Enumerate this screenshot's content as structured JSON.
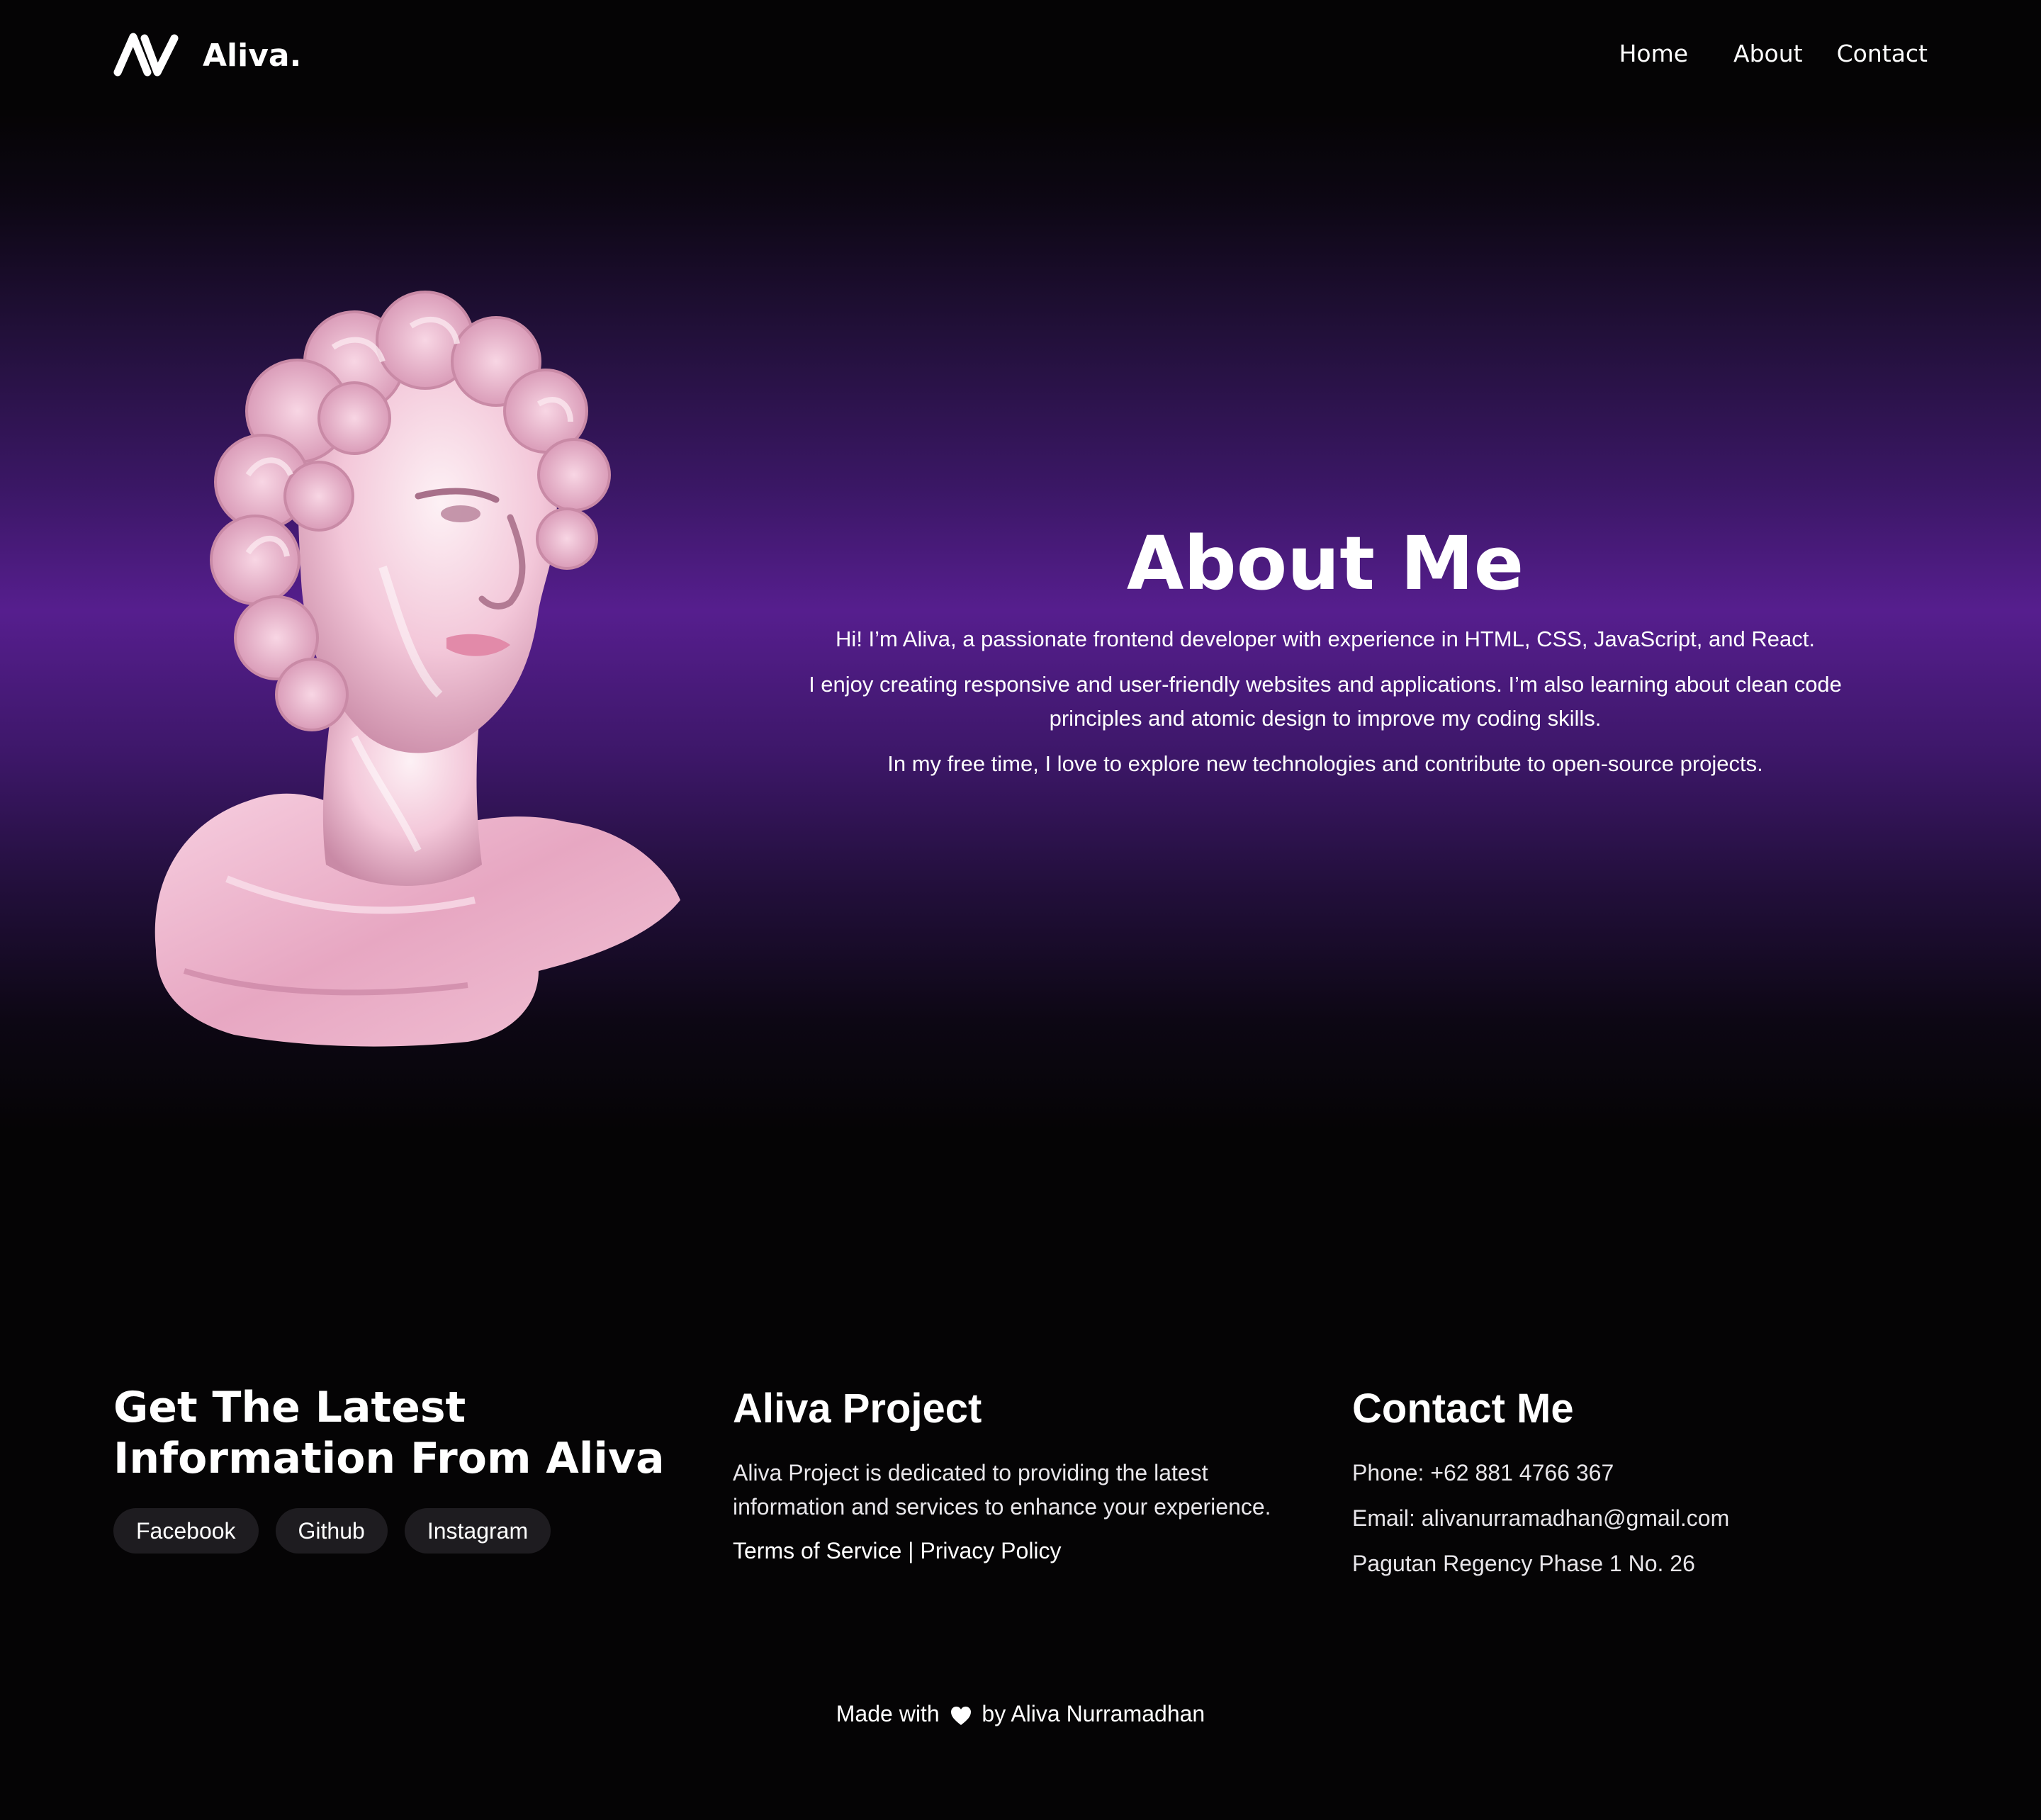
{
  "header": {
    "brand": "Aliva.",
    "nav": {
      "home": "Home",
      "about": "About",
      "contact": "Contact"
    }
  },
  "hero": {
    "title": "About Me",
    "paragraphs": [
      "Hi! I’m Aliva, a passionate frontend developer with experience in HTML, CSS, JavaScript, and React.",
      "I enjoy creating responsive and user-friendly websites and applications. I’m also learning about clean code principles and atomic design to improve my coding skills.",
      "In my free time, I love to explore new technologies and contribute to open-source projects."
    ],
    "gradient_accent": "#561e8e",
    "statue_colors": [
      "#f6c9dc",
      "#fdf1f5",
      "#d78fb0"
    ]
  },
  "footer": {
    "col1": {
      "heading": "Get The Latest Information From Aliva",
      "socials": [
        "Facebook",
        "Github",
        "Instagram"
      ]
    },
    "col2": {
      "heading": "Aliva Project",
      "description": "Aliva Project is dedicated to providing the latest information and services to enhance your experience.",
      "terms": "Terms of Service",
      "separator": "|",
      "privacy": "Privacy Policy"
    },
    "col3": {
      "heading": "Contact Me",
      "phone": "Phone: +62 881 4766 367",
      "email": "Email: alivanurramadhan@gmail.com",
      "address": "Pagutan Regency Phase 1 No. 26"
    },
    "made_with_prefix": "Made with",
    "made_with_suffix": "by Aliva Nurramadhan",
    "heart_icon": "heart-icon"
  }
}
